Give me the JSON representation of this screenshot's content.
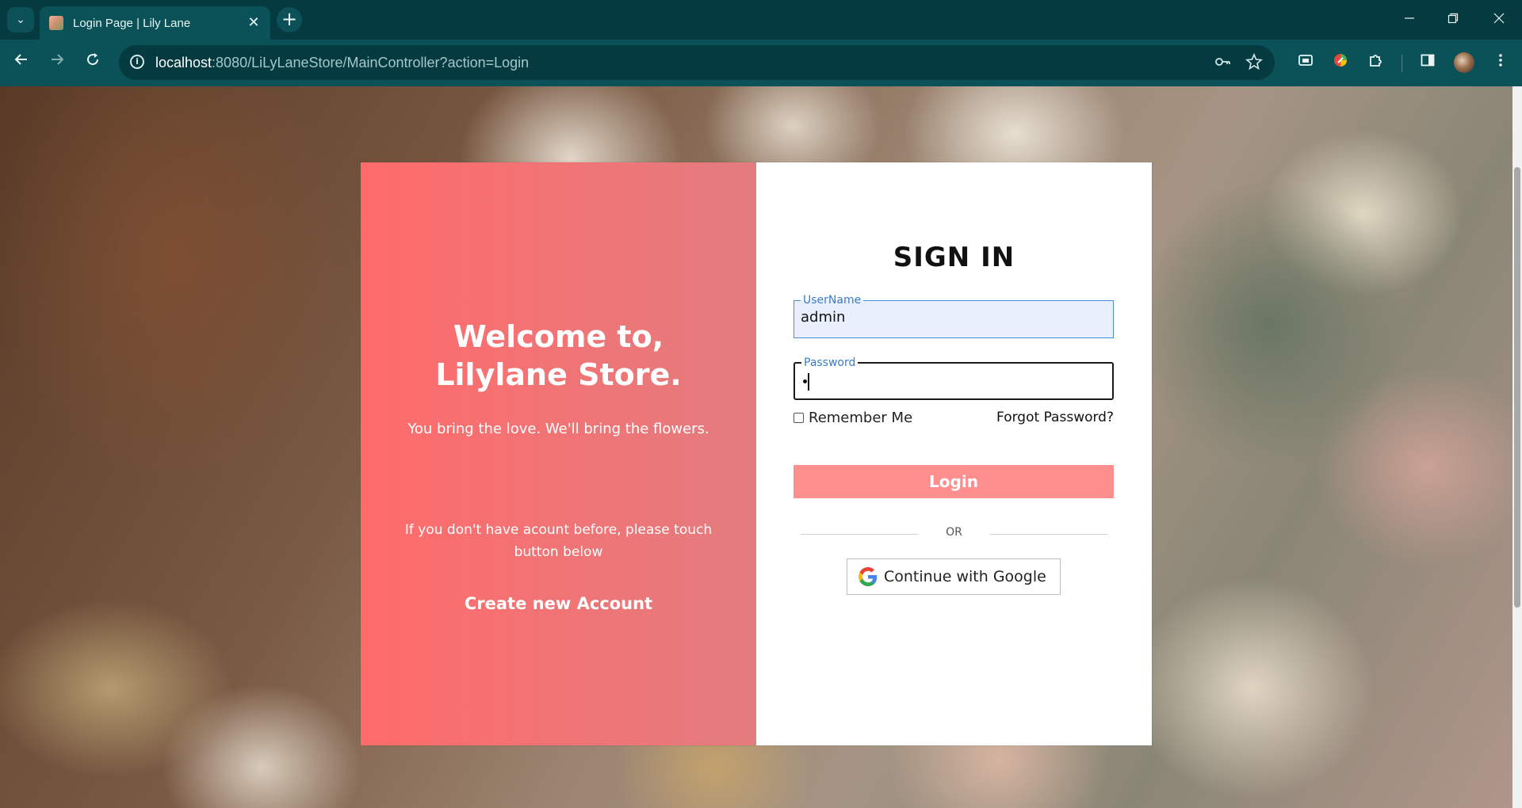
{
  "browser": {
    "tab_title": "Login Page | Lily Lane",
    "tab_close_glyph": "✕",
    "new_tab_glyph": "+",
    "url_host": "localhost",
    "url_rest": ":8080/LiLyLaneStore/MainController?action=Login",
    "icons": {
      "tab_search": "chevron-down-icon",
      "minimize": "minimize-icon",
      "restore": "restore-icon",
      "close": "close-icon",
      "back": "back-arrow-icon",
      "forward": "forward-arrow-icon",
      "reload": "reload-icon",
      "site_info": "info-icon",
      "passwords": "key-icon",
      "bookmark": "star-icon",
      "media": "media-icon",
      "extension_color": "color-extension-icon",
      "extensions": "puzzle-icon",
      "side_panel": "side-panel-icon",
      "profile": "avatar",
      "menu": "kebab-menu-icon"
    },
    "colors": {
      "frame": "#053b40",
      "toolbar": "#0a5258"
    }
  },
  "welcome": {
    "title": "Welcome to, Lilylane Store.",
    "tagline": "You bring the love. We'll bring the flowers.",
    "note": "If you don't have acount before, please touch button below",
    "create_account": "Create new Account",
    "colors": {
      "gradient_start": "#ff6b6b",
      "gradient_end": "#e37c7f"
    }
  },
  "signin": {
    "heading": "SIGN IN",
    "username_label": "UserName",
    "username_value": "admin",
    "password_label": "Password",
    "remember_label": "Remember Me",
    "remember_checked": false,
    "forgot_password": "Forgot Password?",
    "login_button": "Login",
    "or_text": "OR",
    "google_button": "Continue with Google",
    "colors": {
      "login_button": "#ff8e8e",
      "field_accent": "#3a7bc8"
    }
  }
}
